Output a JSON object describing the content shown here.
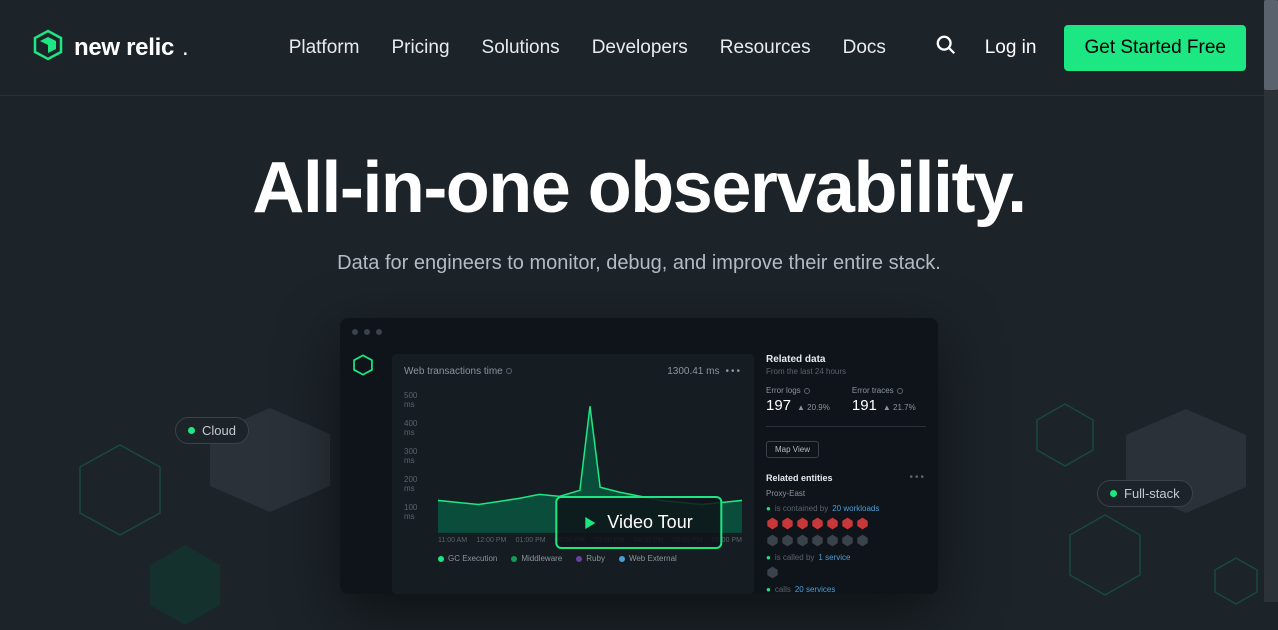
{
  "brand": {
    "name": "new relic"
  },
  "nav": {
    "items": [
      "Platform",
      "Pricing",
      "Solutions",
      "Developers",
      "Resources",
      "Docs"
    ]
  },
  "header": {
    "login": "Log in",
    "cta": "Get Started Free"
  },
  "hero": {
    "title": "All-in-one observability.",
    "subtitle": "Data for engineers to monitor, debug, and improve their entire stack."
  },
  "video": {
    "label": "Video Tour"
  },
  "badges": {
    "cloud": "Cloud",
    "fullstack": "Full-stack"
  },
  "dashboard": {
    "chart": {
      "title": "Web transactions time",
      "value": "1300.41 ms"
    },
    "related": {
      "title": "Related data",
      "subtitle": "From the last 24 hours"
    },
    "stats": {
      "logs": {
        "label": "Error logs",
        "value": "197",
        "delta": "▲ 20.9%"
      },
      "traces": {
        "label": "Error traces",
        "value": "191",
        "delta": "▲ 21.7%"
      }
    },
    "mapview": "Map View",
    "entities": {
      "title": "Related entities",
      "name": "Proxy-East",
      "rel1_prefix": "is contained by",
      "rel1_count": "20 workloads",
      "rel2_prefix": "is called by",
      "rel2_count": "1 service",
      "rel3_prefix": "calls",
      "rel3_count": "20 services"
    }
  },
  "chart_data": {
    "type": "area",
    "title": "Web transactions time",
    "ylabel": "ms",
    "ylim": [
      0,
      500
    ],
    "yticks": [
      "500 ms",
      "400 ms",
      "300 ms",
      "200 ms",
      "100 ms"
    ],
    "xticks": [
      "11:00 AM",
      "12:00 PM",
      "01:00 PM",
      "02:00 PM",
      "03:00 PM",
      "04:00 PM",
      "05:00 PM",
      "06:00 PM"
    ],
    "series": [
      {
        "name": "GC Execution",
        "color": "#1ce783"
      },
      {
        "name": "Middleware",
        "color": "#0f9d58"
      },
      {
        "name": "Ruby",
        "color": "#6b3fa0"
      },
      {
        "name": "Web External",
        "color": "#4c9ed9"
      }
    ],
    "values": [
      120,
      115,
      110,
      118,
      125,
      130,
      128,
      135,
      450,
      140,
      130,
      125,
      120,
      118,
      115,
      120
    ]
  }
}
